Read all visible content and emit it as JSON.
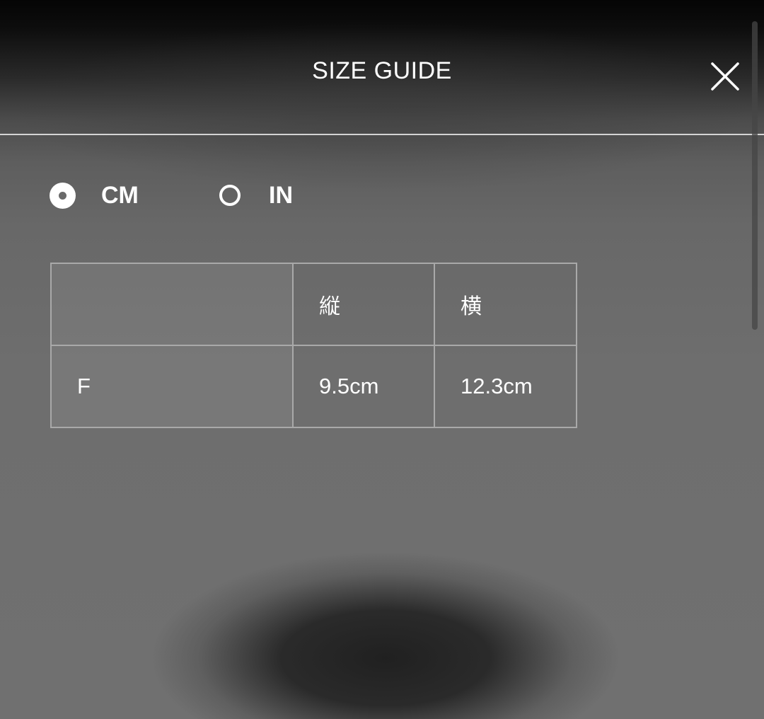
{
  "header": {
    "title": "SIZE GUIDE",
    "close_icon": "close-icon"
  },
  "units": {
    "options": [
      {
        "label": "CM",
        "selected": true
      },
      {
        "label": "IN",
        "selected": false
      }
    ]
  },
  "table": {
    "headers": [
      "",
      "縦",
      "横"
    ],
    "rows": [
      [
        "F",
        "9.5cm",
        "12.3cm"
      ]
    ]
  },
  "colors": {
    "text": "#ffffff",
    "divider": "#ebebeb",
    "table_border": "#a9a9a9"
  }
}
